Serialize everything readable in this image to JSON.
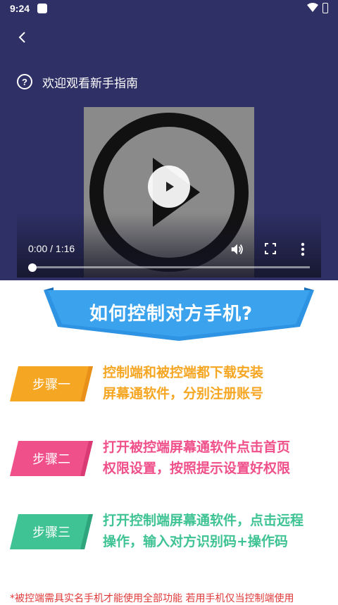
{
  "status_bar": {
    "time": "9:24"
  },
  "header": {
    "guide_title": "欢迎观看新手指南"
  },
  "video": {
    "time_display": "0:00 / 1:16",
    "progress": 0
  },
  "banner": {
    "title": "如何控制对方手机?"
  },
  "steps": [
    {
      "label": "步骤一",
      "line1": "控制端和被控端都下载安装",
      "line2": "屏幕通软件，分别注册账号",
      "color": "#f5a623"
    },
    {
      "label": "步骤二",
      "line1": "打开被控端屏幕通软件点击首页",
      "line2": "权限设置，按照提示设置好权限",
      "color": "#f0508a"
    },
    {
      "label": "步骤三",
      "line1": "打开控制端屏幕通软件，点击远程",
      "line2": "操作，输入对方识别码+操作码",
      "color": "#3fc394"
    }
  ],
  "note": "*被控端需具实名手机才能使用全部功能 若用手机仅当控制端使用"
}
